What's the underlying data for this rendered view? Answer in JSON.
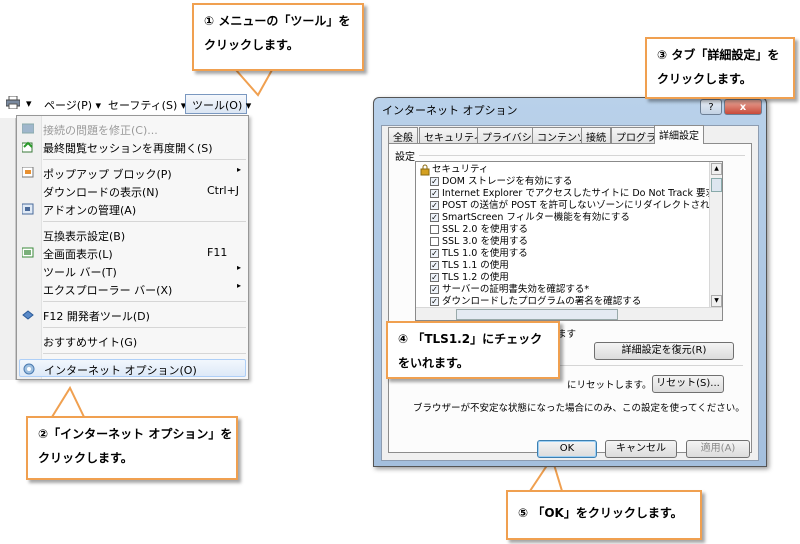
{
  "callouts": {
    "step1": {
      "line1": "① メニューの「ツール」を",
      "line2": "クリックします。"
    },
    "step2": {
      "line1": "②「インターネット オプション」を",
      "line2": "クリックします。"
    },
    "step3": {
      "line1": "③ タブ「詳細設定」を",
      "line2": "クリックします。"
    },
    "step4": {
      "line1": "④ 「TLS1.2」にチェック",
      "line2": "をいれます。"
    },
    "step5": {
      "line1": "⑤ 「OK」をクリックします。"
    }
  },
  "toolbar": {
    "print_arrow": "▾",
    "page": "ページ(P) ▾",
    "safety": "セーフティ(S) ▾",
    "tools": "ツール(O) ▾"
  },
  "menu": {
    "items": [
      {
        "label": "接続の問題を修正(C)...",
        "disabled": true
      },
      {
        "label": "最終閲覧セッションを再度開く(S)"
      },
      {
        "label": "ポップアップ ブロック(P)",
        "submenu": true
      },
      {
        "label": "ダウンロードの表示(N)",
        "shortcut": "Ctrl+J"
      },
      {
        "label": "アドオンの管理(A)"
      },
      {
        "label": "互換表示設定(B)"
      },
      {
        "label": "全画面表示(L)",
        "shortcut": "F11"
      },
      {
        "label": "ツール バー(T)",
        "submenu": true
      },
      {
        "label": "エクスプローラー バー(X)",
        "submenu": true
      },
      {
        "label": "F12 開発者ツール(D)"
      },
      {
        "label": "おすすめサイト(G)"
      },
      {
        "label": "インターネット オプション(O)",
        "highlighted": true
      }
    ],
    "arrow": "▸"
  },
  "dialog": {
    "title": "インターネット オプション",
    "help": "?",
    "close": "x",
    "tabs": [
      "全般",
      "セキュリティ",
      "プライバシー",
      "コンテンツ",
      "接続",
      "プログラム",
      "詳細設定"
    ],
    "selected_tab": "詳細設定",
    "settings_label": "設定",
    "category": "セキュリティ",
    "items": [
      {
        "label": "DOM ストレージを有効にする",
        "checked": true
      },
      {
        "label": "Internet Explorer でアクセスしたサイトに Do Not Track 要求を送信す",
        "checked": true
      },
      {
        "label": "POST の送信が POST を許可しないゾーンにリダイレクトされた場合に警",
        "checked": true
      },
      {
        "label": "SmartScreen フィルター機能を有効にする",
        "checked": true
      },
      {
        "label": "SSL 2.0 を使用する",
        "checked": false
      },
      {
        "label": "SSL 3.0 を使用する",
        "checked": false
      },
      {
        "label": "TLS 1.0 を使用する",
        "checked": true
      },
      {
        "label": "TLS 1.1 の使用",
        "checked": true
      },
      {
        "label": "TLS 1.2 の使用",
        "checked": true
      },
      {
        "label": "サーバーの証明書失効を確認する*",
        "checked": true
      },
      {
        "label": "ダウンロードしたプログラムの署名を確認する",
        "checked": true
      }
    ],
    "restart_note_tail": "ます",
    "restore_button": "詳細設定を復元(R)",
    "reset_note_tail": "にリセットします。",
    "reset_button": "リセット(S)...",
    "unstable_note": "ブラウザーが不安定な状態になった場合にのみ、この設定を使ってください。",
    "ok": "OK",
    "cancel": "キャンセル",
    "apply": "適用(A)",
    "checkmark": "✓"
  },
  "colors": {
    "callout_border": "#f0a050",
    "title_bar": "#b9d1ea"
  }
}
